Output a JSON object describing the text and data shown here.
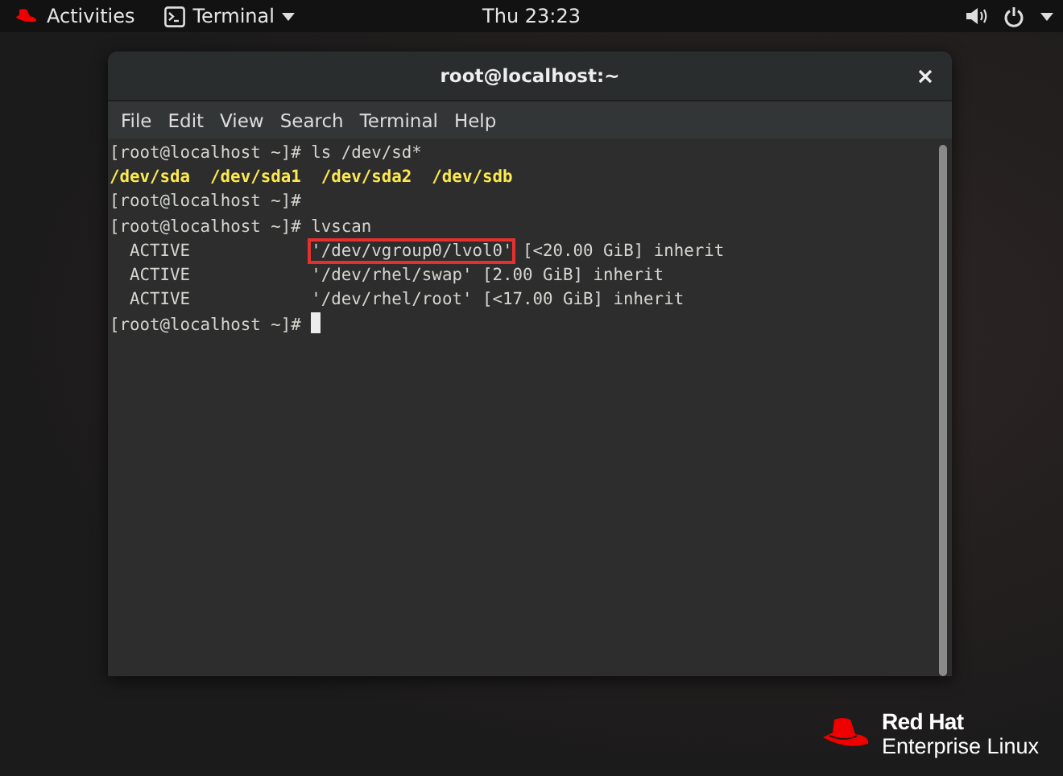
{
  "top_bar": {
    "activities": "Activities",
    "app_menu": "Terminal",
    "clock": "Thu 23:23"
  },
  "window": {
    "title": "root@localhost:~",
    "menu": [
      "File",
      "Edit",
      "View",
      "Search",
      "Terminal",
      "Help"
    ]
  },
  "terminal": {
    "lines": [
      {
        "segments": [
          {
            "kind": "text",
            "text": "[root@localhost ~]# ls /dev/sd*"
          }
        ]
      },
      {
        "segments": [
          {
            "kind": "device",
            "text": "/dev/sda"
          },
          {
            "kind": "device",
            "text": "/dev/sda1"
          },
          {
            "kind": "device",
            "text": "/dev/sda2"
          },
          {
            "kind": "device",
            "text": "/dev/sdb"
          }
        ]
      },
      {
        "segments": [
          {
            "kind": "text",
            "text": "[root@localhost ~]#"
          }
        ]
      },
      {
        "segments": [
          {
            "kind": "text",
            "text": "[root@localhost ~]# lvscan"
          }
        ]
      },
      {
        "segments": [
          {
            "kind": "text",
            "text": "  ACTIVE            "
          },
          {
            "kind": "boxed",
            "text": "'/dev/vgroup0/lvol0'"
          },
          {
            "kind": "text",
            "text": " [<20.00 GiB] inherit"
          }
        ]
      },
      {
        "segments": [
          {
            "kind": "text",
            "text": "  ACTIVE            '/dev/rhel/swap' [2.00 GiB] inherit"
          }
        ]
      },
      {
        "segments": [
          {
            "kind": "text",
            "text": "  ACTIVE            '/dev/rhel/root' [<17.00 GiB] inherit"
          }
        ]
      },
      {
        "segments": [
          {
            "kind": "text",
            "text": "[root@localhost ~]#"
          },
          {
            "kind": "cursor"
          }
        ]
      }
    ]
  },
  "branding": {
    "brand": "Red Hat",
    "product": "Enterprise Linux"
  }
}
